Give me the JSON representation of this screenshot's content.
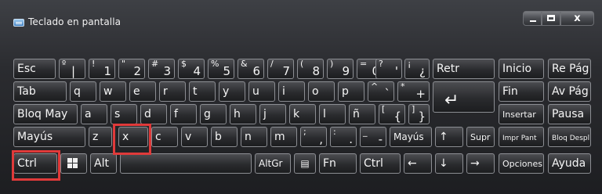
{
  "window": {
    "title": "Teclado en pantalla",
    "controls": {
      "minimize": "minimize",
      "maximize": "maximize",
      "close": "x"
    }
  },
  "keys": {
    "esc": "Esc",
    "k1": {
      "shift": "º",
      "base": "1",
      "alt": "|"
    },
    "k2": {
      "shift": "!",
      "base": "2",
      "alt": "\""
    },
    "k3": {
      "shift": "#",
      "base": "3",
      "alt": "\""
    },
    "k4": {
      "shift": "$",
      "base": "4",
      "alt": "\""
    },
    "k5": {
      "shift": "%",
      "base": "5",
      "alt": "\""
    },
    "k6": {
      "shift": "&",
      "base": "6",
      "alt": "\""
    },
    "k7": {
      "shift": "/",
      "base": "7",
      "alt": "\""
    },
    "k8": {
      "shift": "(",
      "base": "8",
      "alt": "\""
    },
    "k9": {
      "shift": ")",
      "base": "9",
      "alt": "\""
    },
    "k0": {
      "shift": "=",
      "base": "0",
      "alt": "\""
    },
    "apos": {
      "shift": "?",
      "base": "'"
    },
    "inv": {
      "shift": "¡",
      "base": "¿"
    },
    "retr": "Retr",
    "inicio": "Inicio",
    "repag": "Re Pág",
    "tab": "Tab",
    "q": "q",
    "w": "w",
    "e": "e",
    "r": "r",
    "t": "t",
    "y": "y",
    "u": "u",
    "i": "i",
    "o": "o",
    "p": "p",
    "grave": {
      "shift": "^",
      "base": "`"
    },
    "plus": {
      "shift": "*",
      "base": "+"
    },
    "fin": "Fin",
    "avpag": "Av Pág",
    "bloqmay": "Bloq May",
    "a": "a",
    "s": "s",
    "d": "d",
    "f": "f",
    "g": "g",
    "h": "h",
    "j": "j",
    "k": "k",
    "l": "l",
    "ntilde": "ñ",
    "lbrace": {
      "shift": "[",
      "base": "{"
    },
    "rbrace": {
      "shift": "]",
      "base": "}"
    },
    "insertar": "Insertar",
    "pausa": "Pausa",
    "mayus_left": "Mayús",
    "z": "z",
    "x": "x",
    "c": "c",
    "v": "v",
    "b": "b",
    "n": "n",
    "m": "m",
    "comma": {
      "shift": ";",
      "base": ","
    },
    "period": {
      "shift": ":",
      "base": "."
    },
    "minus": {
      "shift": "_",
      "base": "-"
    },
    "mayus_right": "Mayús",
    "up": "↑",
    "supr": "Supr",
    "imprpant": "Impr Pant",
    "bloqdespl": "Bloq Despl",
    "ctrl_left": "Ctrl",
    "alt": "Alt",
    "altgr": "AltGr",
    "fn": "Fn",
    "ctrl_right": "Ctrl",
    "left": "←",
    "down": "↓",
    "right": "→",
    "opciones": "Opciones",
    "ayuda": "Ayuda"
  },
  "icons": {
    "enter": "↵",
    "windows": "windows-logo",
    "menu": "▤"
  },
  "colors": {
    "highlight": "#e03a3a",
    "key_border": "#8b8d92",
    "key_text": "#f5f5f5"
  }
}
